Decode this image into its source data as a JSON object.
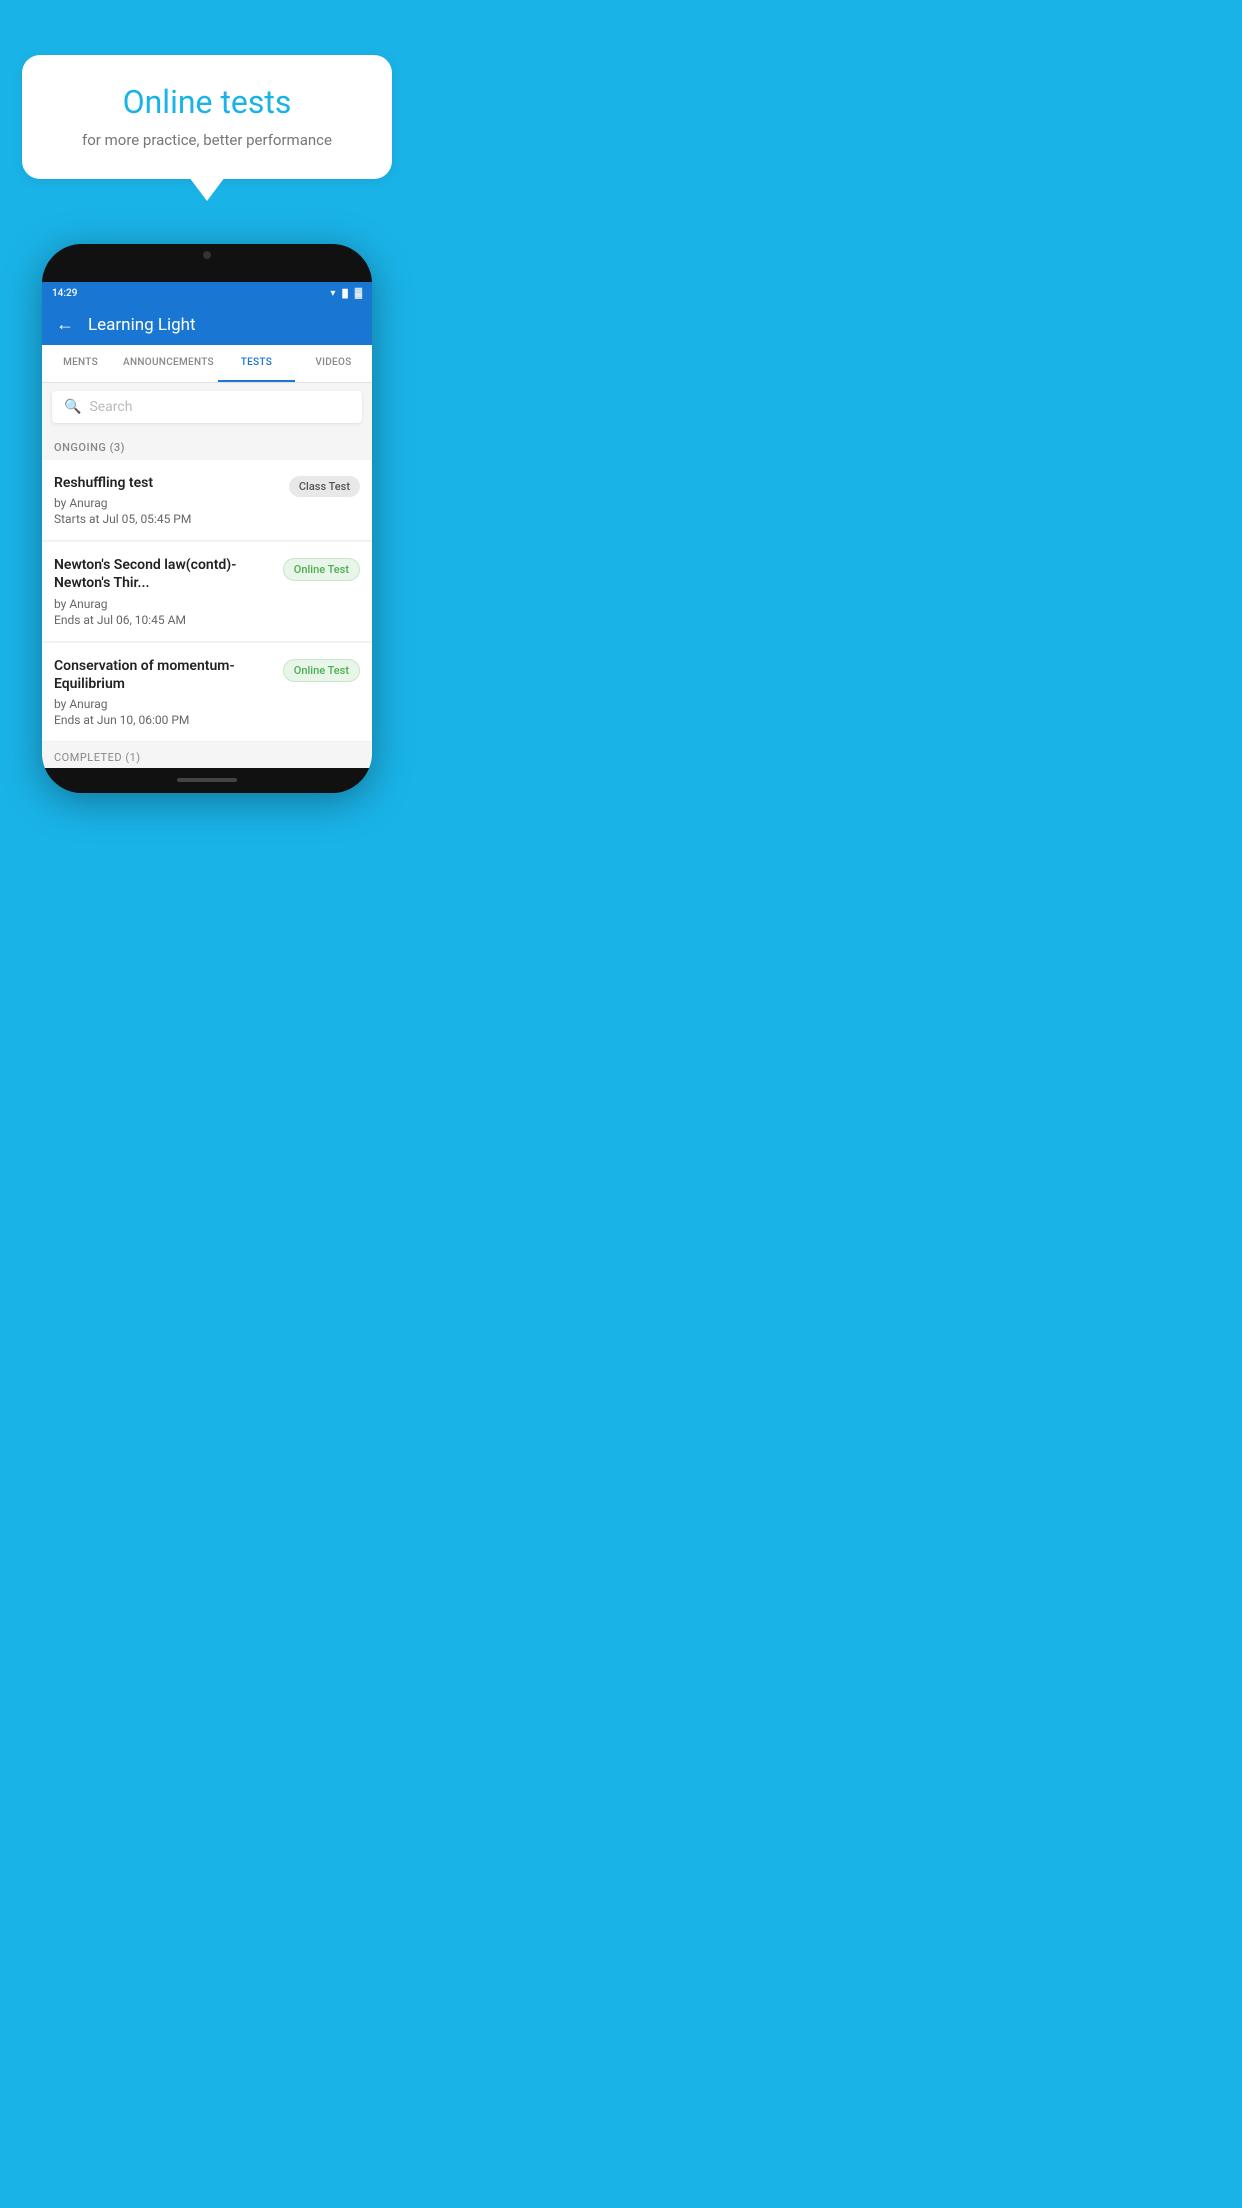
{
  "background_color": "#1ab3e8",
  "speech_bubble": {
    "title": "Online tests",
    "subtitle": "for more practice, better performance"
  },
  "phone": {
    "status_bar": {
      "time": "14:29",
      "wifi_icon": "wifi",
      "signal_icon": "signal",
      "battery_icon": "battery"
    },
    "header": {
      "back_label": "←",
      "title": "Learning Light"
    },
    "tabs": [
      {
        "label": "MENTS",
        "active": false
      },
      {
        "label": "ANNOUNCEMENTS",
        "active": false
      },
      {
        "label": "TESTS",
        "active": true
      },
      {
        "label": "VIDEOS",
        "active": false
      }
    ],
    "search": {
      "placeholder": "Search",
      "icon": "search"
    },
    "ongoing_section": {
      "header": "ONGOING (3)",
      "items": [
        {
          "title": "Reshuffling test",
          "author": "by Anurag",
          "time_label": "Starts at",
          "time_value": "Jul 05, 05:45 PM",
          "badge": "Class Test",
          "badge_type": "class"
        },
        {
          "title": "Newton's Second law(contd)-Newton's Thir...",
          "author": "by Anurag",
          "time_label": "Ends at",
          "time_value": "Jul 06, 10:45 AM",
          "badge": "Online Test",
          "badge_type": "online"
        },
        {
          "title": "Conservation of momentum-Equilibrium",
          "author": "by Anurag",
          "time_label": "Ends at",
          "time_value": "Jun 10, 06:00 PM",
          "badge": "Online Test",
          "badge_type": "online"
        }
      ]
    },
    "completed_section": {
      "header": "COMPLETED (1)"
    }
  }
}
